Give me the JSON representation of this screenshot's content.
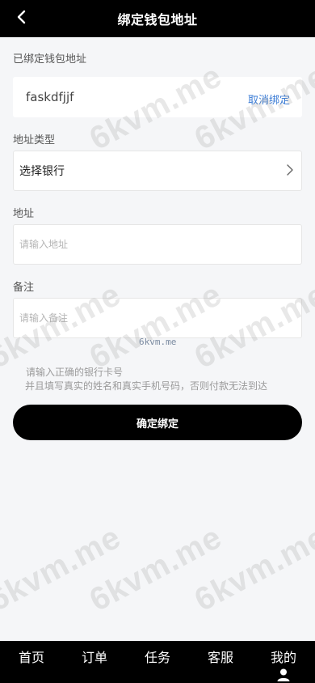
{
  "header": {
    "title": "绑定钱包地址",
    "back_icon": "chevron-left-icon"
  },
  "bound": {
    "label": "已绑定钱包地址",
    "value": "faskdfjjf",
    "unbind_label": "取消绑定"
  },
  "address_type": {
    "label": "地址类型",
    "value": "选择银行"
  },
  "address": {
    "label": "地址",
    "placeholder": "请输入地址"
  },
  "remark": {
    "label": "备注",
    "placeholder": "请输入备注"
  },
  "hint": {
    "line1": "请输入正确的银行卡号",
    "line2": "并且填写真实的姓名和真实手机号码，否则付款无法到达"
  },
  "confirm_label": "确定绑定",
  "watermark": {
    "text": "6kvm.me",
    "small_text": "6kvm.me"
  },
  "nav": {
    "items": [
      {
        "label": "首页"
      },
      {
        "label": "订单"
      },
      {
        "label": "任务"
      },
      {
        "label": "客服"
      },
      {
        "label": "我的"
      }
    ]
  },
  "colors": {
    "header_bg": "#000000",
    "accent_link": "#3a7bd5",
    "button_bg": "#000000",
    "page_bg": "#f5f6f8"
  }
}
